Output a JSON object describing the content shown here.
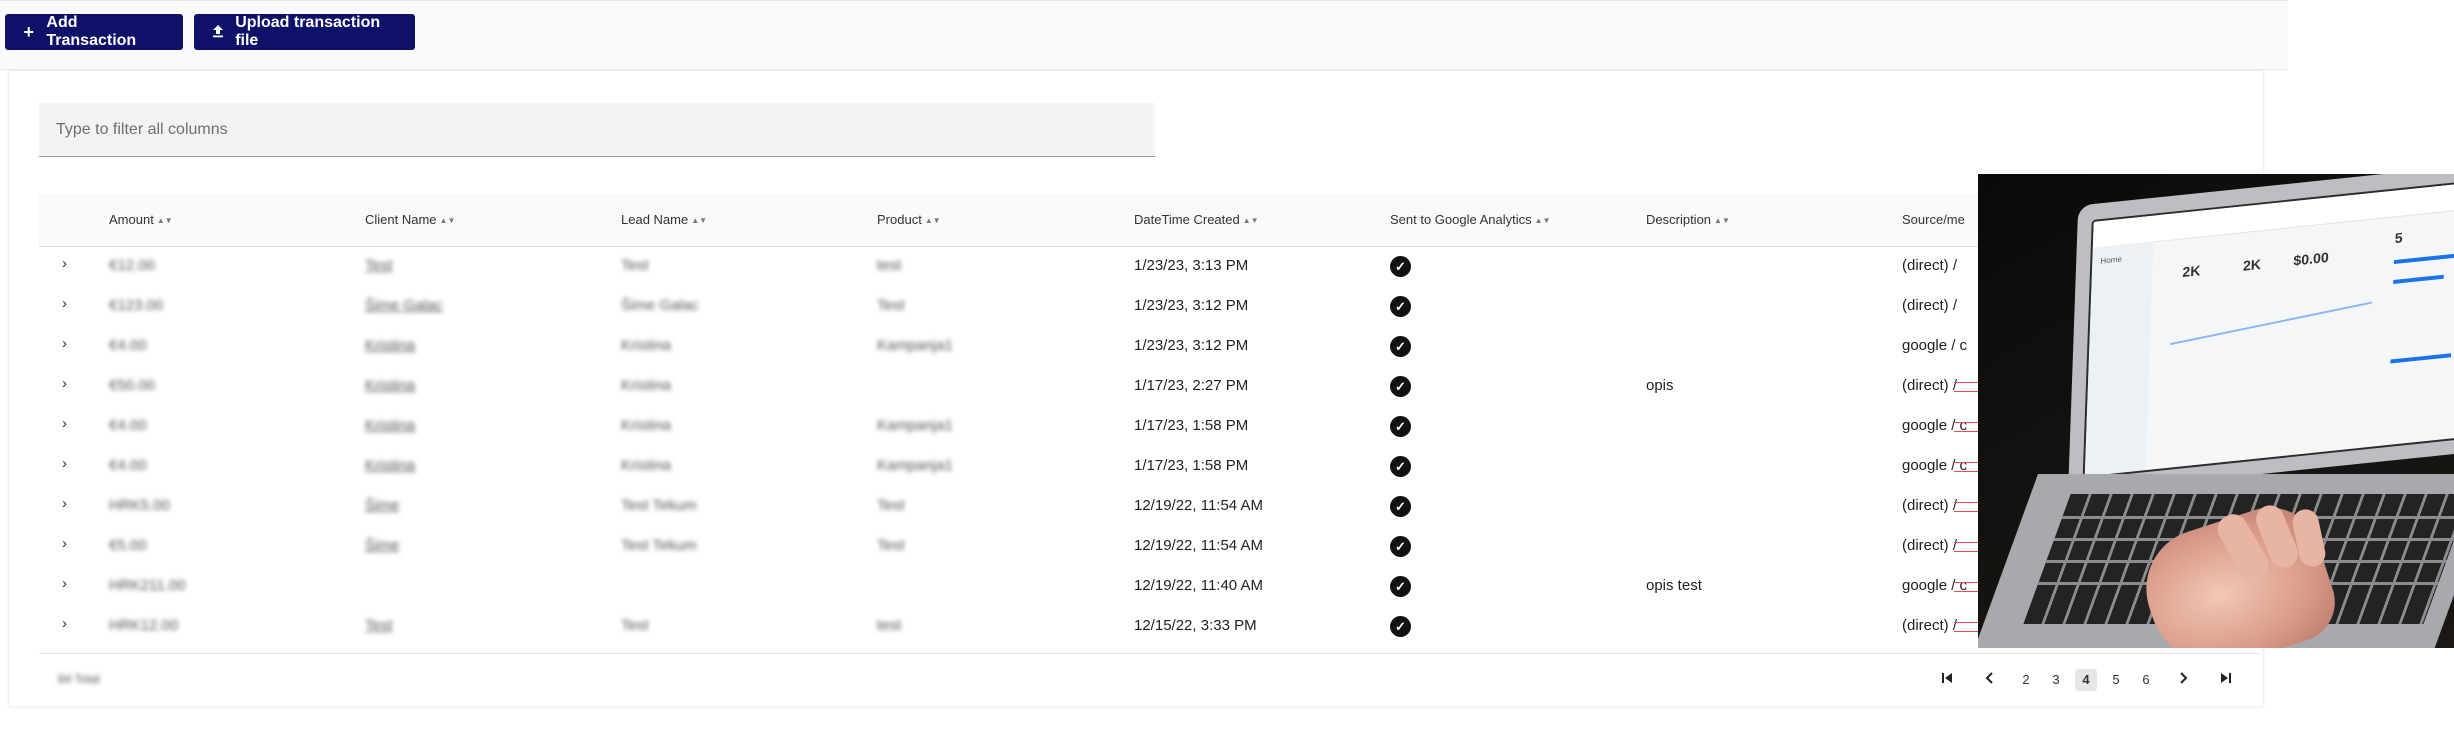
{
  "toolbar": {
    "add_label": "Add Transaction",
    "add_icon": "plus-icon",
    "upload_label": "Upload transaction file",
    "upload_icon": "upload-icon"
  },
  "filter": {
    "placeholder": "Type to filter all columns"
  },
  "columns": [
    {
      "label": "Amount"
    },
    {
      "label": "Client Name"
    },
    {
      "label": "Lead Name"
    },
    {
      "label": "Product"
    },
    {
      "label": "DateTime Created"
    },
    {
      "label": "Sent to Google Analytics"
    },
    {
      "label": "Description"
    },
    {
      "label": "Source/me"
    }
  ],
  "rows": [
    {
      "amount": "€12.00",
      "client": "Test",
      "lead": "Test",
      "product": "test",
      "created": "1/23/23, 3:13 PM",
      "sent": true,
      "description": "",
      "source": "(direct) /"
    },
    {
      "amount": "€123.00",
      "client": "Šime Galac",
      "lead": "Šime Galac",
      "product": "Test",
      "created": "1/23/23, 3:12 PM",
      "sent": true,
      "description": "",
      "source": "(direct) /"
    },
    {
      "amount": "€4.00",
      "client": "Kristina",
      "lead": "Kristina",
      "product": "Kampanja1",
      "created": "1/23/23, 3:12 PM",
      "sent": true,
      "description": "",
      "source": "google / c"
    },
    {
      "amount": "€50.00",
      "client": "Kristina",
      "lead": "Kristina",
      "product": "",
      "created": "1/17/23, 2:27 PM",
      "sent": true,
      "description": "opis",
      "source": "(direct) /"
    },
    {
      "amount": "€4.00",
      "client": "Kristina",
      "lead": "Kristina",
      "product": "Kampanja1",
      "created": "1/17/23, 1:58 PM",
      "sent": true,
      "description": "",
      "source": "google / c"
    },
    {
      "amount": "€4.00",
      "client": "Kristina",
      "lead": "Kristina",
      "product": "Kampanja1",
      "created": "1/17/23, 1:58 PM",
      "sent": true,
      "description": "",
      "source": "google / c"
    },
    {
      "amount": "HRK5.00",
      "client": "Šime",
      "lead": "Test Tekum",
      "product": "Test",
      "created": "12/19/22, 11:54 AM",
      "sent": true,
      "description": "",
      "source": "(direct) /"
    },
    {
      "amount": "€5.00",
      "client": "Šime",
      "lead": "Test Tekum",
      "product": "Test",
      "created": "12/19/22, 11:54 AM",
      "sent": true,
      "description": "",
      "source": "(direct) /"
    },
    {
      "amount": "HRK211.00",
      "client": "",
      "lead": "",
      "product": "",
      "created": "12/19/22, 11:40 AM",
      "sent": true,
      "description": "opis test",
      "source": "google / c"
    },
    {
      "amount": "HRK12.00",
      "client": "Test",
      "lead": "Test",
      "product": "test",
      "created": "12/15/22, 3:33 PM",
      "sent": true,
      "description": "",
      "source": "(direct) /"
    }
  ],
  "footer": {
    "rows_total": "84 Total",
    "pages": [
      "2",
      "3",
      "4",
      "5",
      "6"
    ],
    "current_page": "4",
    "first_icon": "first-page-icon",
    "prev_icon": "chevron-left-icon",
    "next_icon": "chevron-right-icon",
    "last_icon": "last-page-icon"
  },
  "overlay": {
    "image": "laptop-analytics-photo"
  }
}
